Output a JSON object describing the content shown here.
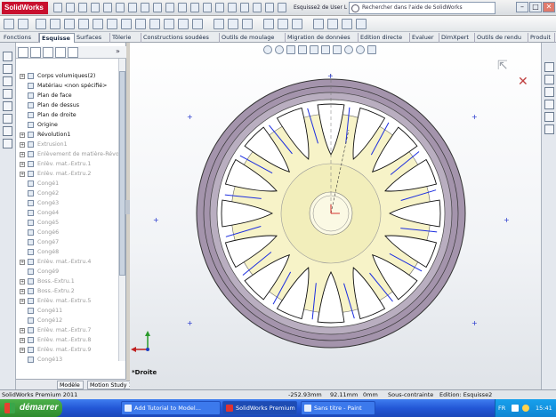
{
  "app": {
    "logo_text": "SolidWorks",
    "doc_title": "Esquisse2 de User Library-jante...",
    "help_search_placeholder": "Rechercher dans l'aide de SolidWorks",
    "window_buttons": [
      "–",
      "□",
      "✕"
    ]
  },
  "tabs": [
    {
      "label": "Fonctions",
      "active": false
    },
    {
      "label": "Esquisse",
      "active": true
    },
    {
      "label": "Surfaces",
      "active": false
    },
    {
      "label": "Tôlerie",
      "active": false
    },
    {
      "label": "Constructions soudées",
      "active": false
    },
    {
      "label": "Outils de moulage",
      "active": false
    },
    {
      "label": "Migration de données",
      "active": false
    },
    {
      "label": "Edition directe",
      "active": false
    },
    {
      "label": "Evaluer",
      "active": false
    },
    {
      "label": "DimXpert",
      "active": false
    },
    {
      "label": "Outils de rendu",
      "active": false
    },
    {
      "label": "Produit",
      "active": false
    }
  ],
  "tree": {
    "items": [
      {
        "label": "Corps volumiques(2)",
        "indent": 1,
        "expand": "+",
        "grey": false
      },
      {
        "label": "Matériau <non spécifié>",
        "indent": 1,
        "expand": "",
        "grey": false
      },
      {
        "label": "Plan de face",
        "indent": 1,
        "expand": "",
        "grey": false
      },
      {
        "label": "Plan de dessus",
        "indent": 1,
        "expand": "",
        "grey": false
      },
      {
        "label": "Plan de droite",
        "indent": 1,
        "expand": "",
        "grey": false
      },
      {
        "label": "Origine",
        "indent": 1,
        "expand": "",
        "grey": false
      },
      {
        "label": "Révolution1",
        "indent": 1,
        "expand": "+",
        "grey": false
      },
      {
        "label": "Extrusion1",
        "indent": 1,
        "expand": "+",
        "grey": true
      },
      {
        "label": "Enlèvement de matière-Révol...",
        "indent": 1,
        "expand": "+",
        "grey": true
      },
      {
        "label": "Enlèv. mat.-Extru.1",
        "indent": 1,
        "expand": "+",
        "grey": true
      },
      {
        "label": "Enlèv. mat.-Extru.2",
        "indent": 1,
        "expand": "+",
        "grey": true
      },
      {
        "label": "Congé1",
        "indent": 1,
        "expand": "",
        "grey": true
      },
      {
        "label": "Congé2",
        "indent": 1,
        "expand": "",
        "grey": true
      },
      {
        "label": "Congé3",
        "indent": 1,
        "expand": "",
        "grey": true
      },
      {
        "label": "Congé4",
        "indent": 1,
        "expand": "",
        "grey": true
      },
      {
        "label": "Congé5",
        "indent": 1,
        "expand": "",
        "grey": true
      },
      {
        "label": "Congé6",
        "indent": 1,
        "expand": "",
        "grey": true
      },
      {
        "label": "Congé7",
        "indent": 1,
        "expand": "",
        "grey": true
      },
      {
        "label": "Congé8",
        "indent": 1,
        "expand": "",
        "grey": true
      },
      {
        "label": "Enlèv. mat.-Extru.4",
        "indent": 1,
        "expand": "+",
        "grey": true
      },
      {
        "label": "Congé9",
        "indent": 1,
        "expand": "",
        "grey": true
      },
      {
        "label": "Boss.-Extru.1",
        "indent": 1,
        "expand": "+",
        "grey": true
      },
      {
        "label": "Boss.-Extru.2",
        "indent": 1,
        "expand": "+",
        "grey": true
      },
      {
        "label": "Enlèv. mat.-Extru.5",
        "indent": 1,
        "expand": "+",
        "grey": true
      },
      {
        "label": "Congé11",
        "indent": 1,
        "expand": "",
        "grey": true
      },
      {
        "label": "Congé12",
        "indent": 1,
        "expand": "",
        "grey": true
      },
      {
        "label": "Enlèv. mat.-Extru.7",
        "indent": 1,
        "expand": "+",
        "grey": true
      },
      {
        "label": "Enlèv. mat.-Extru.8",
        "indent": 1,
        "expand": "+",
        "grey": true
      },
      {
        "label": "Enlèv. mat.-Extru.9",
        "indent": 1,
        "expand": "+",
        "grey": true
      },
      {
        "label": "Congé13",
        "indent": 1,
        "expand": "",
        "grey": true
      }
    ]
  },
  "bottom_tabs": [
    "Modèle",
    "Motion Study 1"
  ],
  "viewport": {
    "view_label": "*Droite"
  },
  "status": {
    "left": "SolidWorks Premium 2011",
    "x": "-252.93mm",
    "y": "92.11mm",
    "z": "0mm",
    "constraint": "Sous-contrainte",
    "editing": "Edition: Esquisse2"
  },
  "taskbar": {
    "start": "démarrer",
    "tasks": [
      {
        "label": "Add Tutorial to Model...",
        "active": false
      },
      {
        "label": "SolidWorks Premium 2...",
        "active": true
      },
      {
        "label": "Sans titre - Paint",
        "active": false
      }
    ],
    "lang": "FR",
    "clock": "15:41"
  },
  "colors": {
    "rim_outer": "#a494ac",
    "rim_inner_ring": "#ffffff",
    "hub": "#f7f3c8",
    "spoke_line_blue": "#1c2ee0",
    "spoke_line_black": "#111111",
    "taskbar": "#2357d6"
  }
}
